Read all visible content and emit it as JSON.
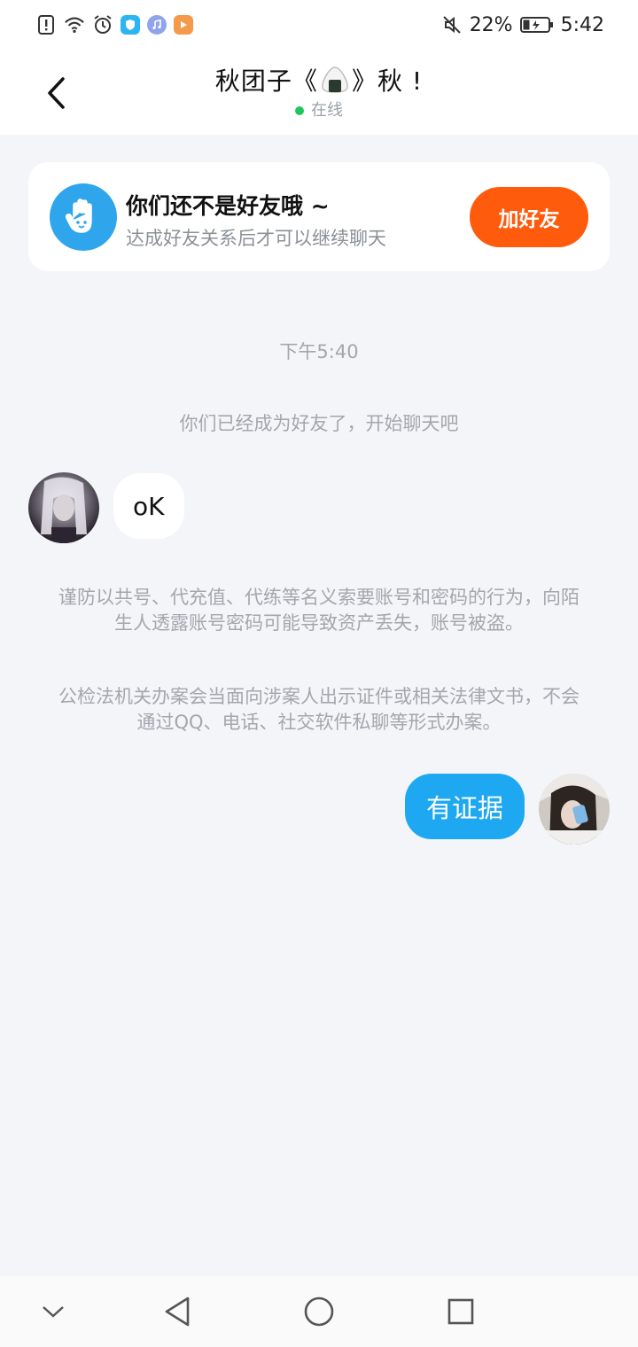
{
  "status_bar": {
    "battery": "22%",
    "time": "5:42",
    "icons": [
      "alert-icon",
      "wifi-icon",
      "alarm-icon",
      "shield-app-icon",
      "music-app-icon",
      "video-app-icon",
      "mute-icon",
      "battery-icon"
    ]
  },
  "header": {
    "title_prefix": "秋团子《",
    "title_suffix": "》秋 !",
    "status": "在线"
  },
  "friend_card": {
    "title": "你们还不是好友哦 ~",
    "subtitle": "达成好友关系后才可以继续聊天",
    "button": "加好友"
  },
  "chat": {
    "timestamp": "下午5:40",
    "system_message": "你们已经成为好友了，开始聊天吧",
    "messages": [
      {
        "from": "other",
        "text": "oK"
      },
      {
        "from": "me",
        "text": "有证据"
      }
    ],
    "warning_1": "谨防以共号、代充值、代练等名义索要账号和密码的行为，向陌生人透露账号密码可能导致资产丢失，账号被盗。",
    "warning_2": "公检法机关办案会当面向涉案人出示证件或相关法律文书，不会通过QQ、电话、社交软件私聊等形式办案。"
  },
  "colors": {
    "accent_blue": "#1ea8f2",
    "add_button": "#ff5b0d",
    "online": "#22c55e",
    "background": "#f3f5f9"
  }
}
